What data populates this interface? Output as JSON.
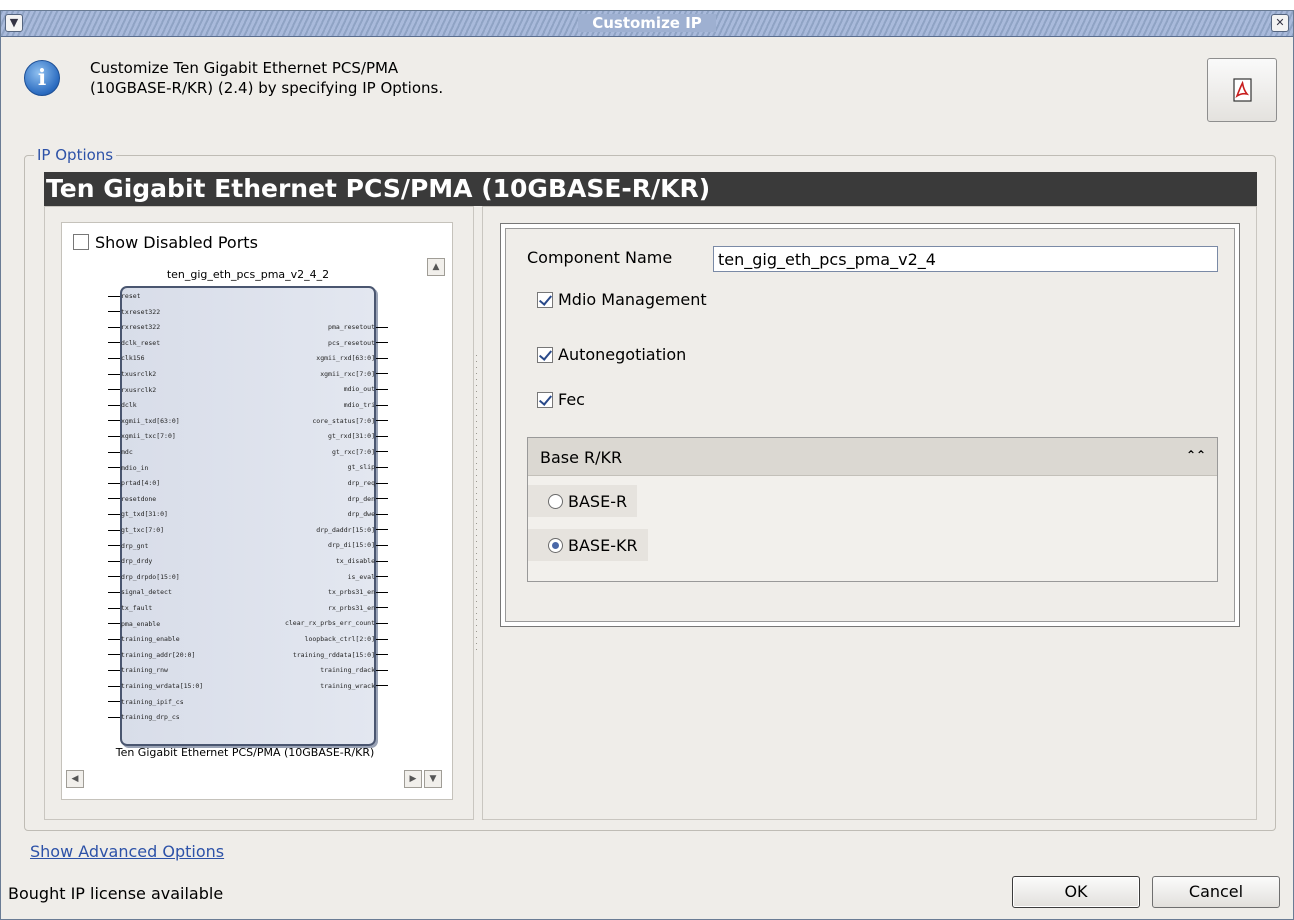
{
  "window": {
    "title": "Customize IP",
    "menu_icon": "chevron-down-icon",
    "close_icon": "close-icon"
  },
  "header": {
    "description": "Customize Ten Gigabit Ethernet PCS/PMA (10GBASE-R/KR) (2.4) by specifying IP Options.",
    "info_icon": "info-icon",
    "doc_icon": "pdf-icon"
  },
  "ip_options": {
    "legend": "IP Options",
    "banner": "Ten Gigabit Ethernet PCS/PMA (10GBASE-R/KR)"
  },
  "symbol": {
    "show_disabled_ports_label": "Show Disabled Ports",
    "show_disabled_ports_checked": false,
    "block_title": "ten_gig_eth_pcs_pma_v2_4_2",
    "block_caption": "Ten Gigabit Ethernet PCS/PMA (10GBASE-R/KR)",
    "left_ports": [
      "reset",
      "txreset322",
      "rxreset322",
      "dclk_reset",
      "clk156",
      "txusrclk2",
      "rxusrclk2",
      "dclk",
      "xgmii_txd[63:0]",
      "xgmii_txc[7:0]",
      "mdc",
      "mdio_in",
      "prtad[4:0]",
      "resetdone",
      "gt_txd[31:0]",
      "gt_txc[7:0]",
      "drp_gnt",
      "drp_drdy",
      "drp_drpdo[15:0]",
      "signal_detect",
      "tx_fault",
      "pma_enable",
      "training_enable",
      "training_addr[20:0]",
      "training_rnw",
      "training_wrdata[15:0]",
      "training_ipif_cs",
      "training_drp_cs"
    ],
    "right_ports": [
      "pma_resetout",
      "pcs_resetout",
      "xgmii_rxd[63:0]",
      "xgmii_rxc[7:0]",
      "mdio_out",
      "mdio_tri",
      "core_status[7:0]",
      "gt_rxd[31:0]",
      "gt_rxc[7:0]",
      "gt_slip",
      "drp_req",
      "drp_den",
      "drp_dwe",
      "drp_daddr[15:0]",
      "drp_di[15:0]",
      "tx_disable",
      "is_eval",
      "tx_prbs31_en",
      "rx_prbs31_en",
      "clear_rx_prbs_err_count",
      "loopback_ctrl[2:0]",
      "training_rddata[15:0]",
      "training_rdack",
      "training_wrack"
    ]
  },
  "config": {
    "component_name_label": "Component Name",
    "component_name_value": "ten_gig_eth_pcs_pma_v2_4",
    "mdio_management_label": "Mdio Management",
    "mdio_management_checked": true,
    "autonegotiation_label": "Autonegotiation",
    "autonegotiation_checked": true,
    "fec_label": "Fec",
    "fec_checked": true,
    "base_group_title": "Base R/KR",
    "collapse_icon": "double-chevron-up-icon",
    "base_options": [
      {
        "label": "BASE-R",
        "selected": false
      },
      {
        "label": "BASE-KR",
        "selected": true
      }
    ]
  },
  "footer": {
    "advanced_link": "Show Advanced Options",
    "status": "Bought IP license available",
    "ok_label": "OK",
    "cancel_label": "Cancel"
  }
}
